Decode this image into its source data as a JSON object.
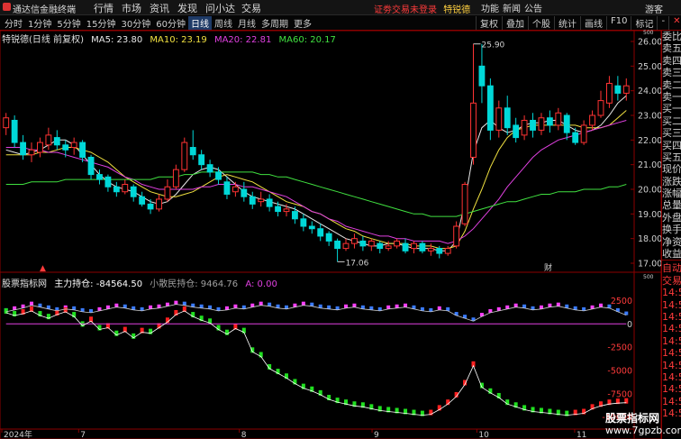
{
  "titlebar": {
    "app_name": "通达信金融终端",
    "menu": [
      "行情",
      "市场",
      "资讯",
      "发现",
      "问小达",
      "交易"
    ],
    "notice": "证劵交易未登录",
    "stock_name": "特锐德",
    "right_menu": [
      "功能",
      "新闻",
      "公告"
    ],
    "guest": "游客"
  },
  "toolbar": {
    "periods": [
      "分时",
      "1分钟",
      "5分钟",
      "15分钟",
      "30分钟",
      "60分钟",
      "日线",
      "周线",
      "月线",
      "多周期",
      "更多"
    ],
    "active_period": "日线",
    "tools": [
      "复权",
      "叠加",
      "个股",
      "统计",
      "画线",
      "F10",
      "标记",
      "-",
      "✕"
    ]
  },
  "main_legend": {
    "title": "特锐德(日线 前复权)",
    "items": [
      {
        "label": "MA5: 23.80",
        "color": "#e8e8e8"
      },
      {
        "label": "MA10: 23.19",
        "color": "#f0e040"
      },
      {
        "label": "MA20: 22.81",
        "color": "#e040e0"
      },
      {
        "label": "MA60: 20.17",
        "color": "#40e040"
      }
    ]
  },
  "sub_legend": {
    "title": "股票指标网",
    "items": [
      {
        "label": "主力持仓: -84564.50",
        "color": "#ffffff"
      },
      {
        "label": "小散民持仓: 9464.76",
        "color": "#a0a0a0"
      },
      {
        "label": "A: 0.00",
        "color": "#e040e0"
      }
    ]
  },
  "price_axis": [
    "26.00",
    "25.00",
    "24.00",
    "23.00",
    "22.00",
    "21.00",
    "20.00",
    "19.00",
    "18.00",
    "17.00"
  ],
  "price_axis_top": "500",
  "sub_axis": [
    "2500",
    "0",
    "-2500",
    "-5000",
    "-7500",
    "-10000"
  ],
  "sub_axis_top": "500",
  "date_axis": [
    "2024年",
    "7",
    "8",
    "9",
    "10",
    "11"
  ],
  "annotations": {
    "high": "25.90",
    "low": "17.06",
    "event_a": "▲",
    "event_b": "财"
  },
  "right_panel": {
    "main": [
      "委比",
      "卖五",
      "卖四",
      "卖三",
      "卖二",
      "卖一",
      "买一",
      "买二",
      "买三",
      "买四",
      "买五",
      "现价",
      "涨跌",
      "涨幅",
      "总量",
      "外盘",
      "换手",
      "净资",
      "收益"
    ],
    "sub": [
      "自动",
      "交易",
      "14:56",
      "14:56",
      "14:56",
      "14:56",
      "14:56",
      "14:56",
      "14:56",
      "14:56",
      "14:56",
      "14:56",
      "14:56"
    ]
  },
  "watermark": {
    "line1": "股票指标网",
    "line2": "www.7gpzb.com"
  },
  "colors": {
    "up": "#ff3333",
    "down": "#00d8d8",
    "ma5": "#e8e8e8",
    "ma10": "#f0e040",
    "ma20": "#e040e0",
    "ma60": "#40e040",
    "grid": "#8b0000"
  },
  "chart_data": [
    {
      "type": "candlestick",
      "title": "特锐德(日线 前复权)",
      "ylim": [
        17,
        26
      ],
      "annotations": [
        {
          "label": "25.90",
          "value": 25.9
        },
        {
          "label": "17.06",
          "value": 17.06
        }
      ],
      "series": [
        {
          "name": "MA5",
          "values": [
            21.6,
            21.5,
            21.4,
            21.5,
            21.6,
            21.8,
            22.0,
            22.0,
            21.8,
            21.4,
            21.0,
            20.6,
            20.3,
            20.1,
            20.0,
            19.9,
            19.7,
            19.5,
            19.4,
            19.5,
            19.8,
            20.2,
            20.6,
            20.8,
            20.9,
            20.8,
            20.5,
            20.2,
            19.9,
            19.7,
            19.6,
            19.5,
            19.4,
            19.3,
            19.2,
            19.0,
            18.8,
            18.6,
            18.4,
            18.2,
            18.0,
            17.9,
            17.8,
            17.7,
            17.7,
            17.8,
            17.8,
            17.7,
            17.6,
            17.6,
            17.6,
            17.5,
            17.5,
            17.9,
            19.5,
            21.5,
            22.5,
            22.8,
            22.5,
            22.3,
            22.4,
            22.6,
            22.7,
            22.7,
            22.8,
            22.8,
            22.6,
            22.4,
            22.3,
            22.4,
            22.6,
            23.0,
            23.5,
            23.8
          ]
        },
        {
          "name": "MA10",
          "values": [
            21.4,
            21.4,
            21.4,
            21.4,
            21.5,
            21.5,
            21.6,
            21.7,
            21.7,
            21.6,
            21.5,
            21.3,
            21.1,
            20.8,
            20.5,
            20.3,
            20.1,
            19.9,
            19.8,
            19.7,
            19.7,
            19.8,
            19.9,
            20.1,
            20.3,
            20.5,
            20.6,
            20.5,
            20.4,
            20.3,
            20.1,
            19.9,
            19.7,
            19.5,
            19.4,
            19.3,
            19.1,
            19.0,
            18.8,
            18.6,
            18.4,
            18.3,
            18.1,
            18.0,
            17.9,
            17.8,
            17.8,
            17.8,
            17.7,
            17.7,
            17.7,
            17.6,
            17.6,
            17.7,
            18.3,
            19.2,
            20.0,
            20.9,
            21.6,
            22.1,
            22.4,
            22.5,
            22.6,
            22.6,
            22.6,
            22.6,
            22.6,
            22.6,
            22.5,
            22.5,
            22.5,
            22.6,
            22.9,
            23.2
          ]
        },
        {
          "name": "MA20",
          "values": [
            21.7,
            21.7,
            21.7,
            21.6,
            21.6,
            21.5,
            21.5,
            21.4,
            21.3,
            21.2,
            21.1,
            21.0,
            20.9,
            20.7,
            20.5,
            20.4,
            20.2,
            20.1,
            20.0,
            20.0,
            20.0,
            20.0,
            20.0,
            20.1,
            20.1,
            20.2,
            20.2,
            20.2,
            20.1,
            20.1,
            20.0,
            19.9,
            19.8,
            19.7,
            19.5,
            19.3,
            19.1,
            19.0,
            18.8,
            18.7,
            18.5,
            18.4,
            18.3,
            18.2,
            18.1,
            18.1,
            18.0,
            18.0,
            17.9,
            17.9,
            17.9,
            17.9,
            17.8,
            17.9,
            18.1,
            18.4,
            18.8,
            19.2,
            19.6,
            20.1,
            20.5,
            20.9,
            21.3,
            21.6,
            21.8,
            22.0,
            22.1,
            22.2,
            22.3,
            22.4,
            22.5,
            22.6,
            22.7,
            22.8
          ]
        },
        {
          "name": "MA60",
          "values": [
            20.2,
            20.2,
            20.2,
            20.3,
            20.3,
            20.3,
            20.3,
            20.4,
            20.4,
            20.4,
            20.4,
            20.4,
            20.4,
            20.4,
            20.4,
            20.4,
            20.4,
            20.4,
            20.5,
            20.5,
            20.5,
            20.6,
            20.6,
            20.7,
            20.7,
            20.7,
            20.7,
            20.7,
            20.7,
            20.7,
            20.6,
            20.6,
            20.5,
            20.5,
            20.4,
            20.3,
            20.2,
            20.1,
            20.0,
            19.9,
            19.8,
            19.7,
            19.6,
            19.5,
            19.4,
            19.3,
            19.2,
            19.1,
            19.0,
            19.0,
            18.9,
            18.9,
            18.9,
            18.9,
            19.0,
            19.1,
            19.2,
            19.3,
            19.4,
            19.5,
            19.5,
            19.6,
            19.7,
            19.8,
            19.8,
            19.9,
            19.9,
            19.9,
            20.0,
            20.0,
            20.0,
            20.1,
            20.1,
            20.2
          ]
        }
      ],
      "candles": [
        [
          22.5,
          22.9,
          23.1,
          22.2
        ],
        [
          22.8,
          21.9,
          23.0,
          21.7
        ],
        [
          21.9,
          21.4,
          22.2,
          21.2
        ],
        [
          21.4,
          21.6,
          21.9,
          21.1
        ],
        [
          21.5,
          21.9,
          22.1,
          21.3
        ],
        [
          21.8,
          22.2,
          22.5,
          21.6
        ],
        [
          22.1,
          21.8,
          22.4,
          21.6
        ],
        [
          21.8,
          21.6,
          22.0,
          21.3
        ],
        [
          21.7,
          21.9,
          22.1,
          21.4
        ],
        [
          21.9,
          21.3,
          22.0,
          21.1
        ],
        [
          21.3,
          20.6,
          21.4,
          20.4
        ],
        [
          20.6,
          20.4,
          20.8,
          20.2
        ],
        [
          20.5,
          20.1,
          20.6,
          19.9
        ],
        [
          20.1,
          19.9,
          20.3,
          19.7
        ],
        [
          19.9,
          20.2,
          20.4,
          19.8
        ],
        [
          20.1,
          19.7,
          20.2,
          19.5
        ],
        [
          19.7,
          19.4,
          19.9,
          19.3
        ],
        [
          19.4,
          19.2,
          19.6,
          19.0
        ],
        [
          19.2,
          19.6,
          19.8,
          19.1
        ],
        [
          19.6,
          20.1,
          20.4,
          19.5
        ],
        [
          20.1,
          20.8,
          21.0,
          20.0
        ],
        [
          20.8,
          21.9,
          22.1,
          20.7
        ],
        [
          21.7,
          21.4,
          22.4,
          21.2
        ],
        [
          21.4,
          21.0,
          21.6,
          20.8
        ],
        [
          21.0,
          20.7,
          21.2,
          20.5
        ],
        [
          20.7,
          20.4,
          20.9,
          20.2
        ],
        [
          20.3,
          19.8,
          20.5,
          19.6
        ],
        [
          19.9,
          20.1,
          20.3,
          19.7
        ],
        [
          20.0,
          19.7,
          20.3,
          19.5
        ],
        [
          19.7,
          19.4,
          19.9,
          19.2
        ],
        [
          19.5,
          19.6,
          19.9,
          19.3
        ],
        [
          19.6,
          19.3,
          19.8,
          19.1
        ],
        [
          19.3,
          19.1,
          19.5,
          18.9
        ],
        [
          19.1,
          19.2,
          19.4,
          18.9
        ],
        [
          19.1,
          18.8,
          19.3,
          18.6
        ],
        [
          18.8,
          18.5,
          19.0,
          18.3
        ],
        [
          18.5,
          18.4,
          18.7,
          18.2
        ],
        [
          18.4,
          18.1,
          18.6,
          17.9
        ],
        [
          18.2,
          17.9,
          18.3,
          17.7
        ],
        [
          17.9,
          17.6,
          18.0,
          17.06
        ],
        [
          17.6,
          17.8,
          18.0,
          17.5
        ],
        [
          17.8,
          18.0,
          18.2,
          17.6
        ],
        [
          17.9,
          17.7,
          18.1,
          17.5
        ],
        [
          17.7,
          17.9,
          18.0,
          17.5
        ],
        [
          17.8,
          17.6,
          17.9,
          17.4
        ],
        [
          17.6,
          17.7,
          17.9,
          17.5
        ],
        [
          17.7,
          17.9,
          18.0,
          17.6
        ],
        [
          17.8,
          17.5,
          18.0,
          17.4
        ],
        [
          17.6,
          17.8,
          17.9,
          17.4
        ],
        [
          17.8,
          17.5,
          17.9,
          17.4
        ],
        [
          17.5,
          17.6,
          17.8,
          17.3
        ],
        [
          17.6,
          17.4,
          17.7,
          17.2
        ],
        [
          17.4,
          17.6,
          17.7,
          17.3
        ],
        [
          17.7,
          18.5,
          18.7,
          17.6
        ],
        [
          18.6,
          20.2,
          20.3,
          18.5
        ],
        [
          21.3,
          23.5,
          25.9,
          21.0
        ],
        [
          25.0,
          24.2,
          25.9,
          23.5
        ],
        [
          24.2,
          22.4,
          24.5,
          22.0
        ],
        [
          22.4,
          23.3,
          23.6,
          22.1
        ],
        [
          23.3,
          22.5,
          23.8,
          22.2
        ],
        [
          22.6,
          22.1,
          22.9,
          21.9
        ],
        [
          22.2,
          22.8,
          23.0,
          22.0
        ],
        [
          22.8,
          22.4,
          23.1,
          22.1
        ],
        [
          22.4,
          22.9,
          23.1,
          22.2
        ],
        [
          22.9,
          22.6,
          23.2,
          22.3
        ],
        [
          22.6,
          23.1,
          23.3,
          22.4
        ],
        [
          23.0,
          22.3,
          23.1,
          22.0
        ],
        [
          22.3,
          21.9,
          22.5,
          21.8
        ],
        [
          21.9,
          22.6,
          22.8,
          21.8
        ],
        [
          22.6,
          23.0,
          23.2,
          22.4
        ],
        [
          23.0,
          23.6,
          24.0,
          22.9
        ],
        [
          23.5,
          24.3,
          24.6,
          23.3
        ],
        [
          24.2,
          23.9,
          24.6,
          23.6
        ],
        [
          23.9,
          24.2,
          24.5,
          23.6
        ]
      ]
    },
    {
      "type": "line",
      "title": "股票指标网",
      "ylim": [
        -11000,
        4000
      ],
      "series": [
        {
          "name": "主力持仓",
          "values": [
            1200,
            900,
            1100,
            1400,
            900,
            600,
            1000,
            1300,
            800,
            -200,
            300,
            -600,
            -400,
            -1200,
            -800,
            -1500,
            -900,
            -1000,
            -400,
            200,
            1000,
            1400,
            800,
            400,
            100,
            -600,
            -1100,
            -500,
            -900,
            -3000,
            -3500,
            -4800,
            -5300,
            -5800,
            -6400,
            -6900,
            -7200,
            -7600,
            -8100,
            -8400,
            -8600,
            -8800,
            -8900,
            -9100,
            -9300,
            -9400,
            -9500,
            -9600,
            -9700,
            -9800,
            -9700,
            -9200,
            -8600,
            -7800,
            -6500,
            -4500,
            -6800,
            -7400,
            -7900,
            -8600,
            -8900,
            -9200,
            -9400,
            -9500,
            -9600,
            -9700,
            -9800,
            -9700,
            -9600,
            -9100,
            -8800,
            -8600,
            -8500,
            -8456
          ]
        },
        {
          "name": "小散民持仓",
          "values": [
            1300,
            1500,
            1700,
            2000,
            1800,
            1600,
            1400,
            1600,
            1500,
            1300,
            1200,
            1400,
            1600,
            1800,
            1700,
            1500,
            1400,
            1600,
            1700,
            1900,
            2100,
            2000,
            1800,
            1700,
            1600,
            1400,
            1500,
            1700,
            1600,
            1800,
            2000,
            1900,
            1700,
            1600,
            1800,
            2000,
            1900,
            1700,
            1600,
            1500,
            1700,
            1800,
            1600,
            1500,
            1400,
            1600,
            1700,
            1800,
            1600,
            1400,
            1300,
            1500,
            1400,
            900,
            600,
            300,
            800,
            1200,
            1400,
            1600,
            1800,
            1700,
            1500,
            1600,
            1800,
            1900,
            1700,
            1500,
            1400,
            1600,
            1800,
            1700,
            1300,
            946
          ]
        },
        {
          "name": "A",
          "values": [
            0,
            0,
            0,
            0,
            0,
            0,
            0,
            0,
            0,
            0,
            0,
            0,
            0,
            0,
            0,
            0,
            0,
            0,
            0,
            0,
            0,
            0,
            0,
            0,
            0,
            0,
            0,
            0,
            0,
            0,
            0,
            0,
            0,
            0,
            0,
            0,
            0,
            0,
            0,
            0,
            0,
            0,
            0,
            0,
            0,
            0,
            0,
            0,
            0,
            0,
            0,
            0,
            0,
            0,
            0,
            0,
            0,
            0,
            0,
            0,
            0,
            0,
            0,
            0,
            0,
            0,
            0,
            0,
            0,
            0,
            0,
            0,
            0,
            0
          ]
        }
      ]
    }
  ]
}
